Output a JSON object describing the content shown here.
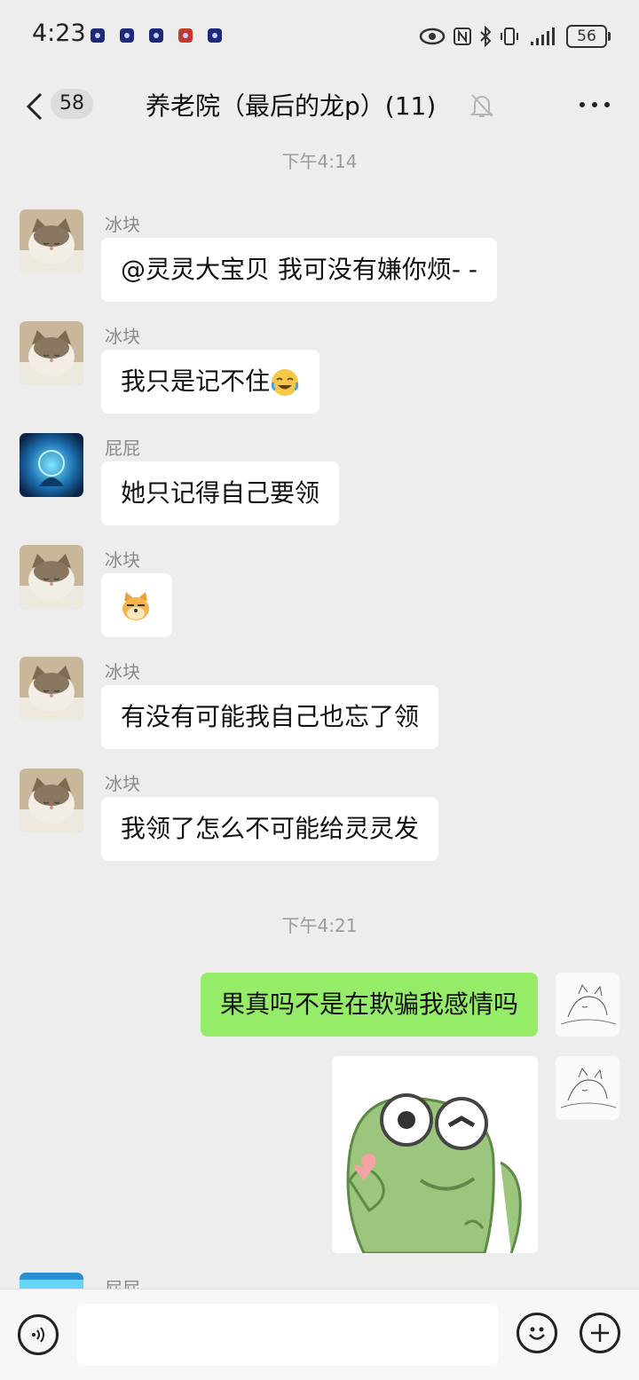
{
  "status": {
    "time": "4:23",
    "battery": "56"
  },
  "header": {
    "back_count": "58",
    "title": "养老院（最后的龙p）(11)"
  },
  "timestamps": [
    "下午4:14",
    "下午4:21"
  ],
  "messages": [
    {
      "sender": "冰块",
      "text": "@灵灵大宝贝  我可没有嫌你烦- -"
    },
    {
      "sender": "冰块",
      "text": "我只是记不住"
    },
    {
      "sender": "屁屁",
      "text": "她只记得自己要领"
    },
    {
      "sender": "冰块",
      "text": ""
    },
    {
      "sender": "冰块",
      "text": "有没有可能我自己也忘了领"
    },
    {
      "sender": "冰块",
      "text": "我领了怎么不可能给灵灵发"
    },
    {
      "sender": "me",
      "text": "果真吗不是在欺骗我感情吗"
    },
    {
      "sender": "屁屁",
      "text": ""
    }
  ],
  "partial_sender": "屁屁",
  "icons": {
    "voice": "voice-icon",
    "emoji": "emoji-icon",
    "add": "add-icon",
    "mute": "bell-off-icon",
    "more": "more-icon"
  },
  "colors": {
    "background": "#ededed",
    "my_bubble": "#95ec69",
    "their_bubble": "#ffffff"
  }
}
